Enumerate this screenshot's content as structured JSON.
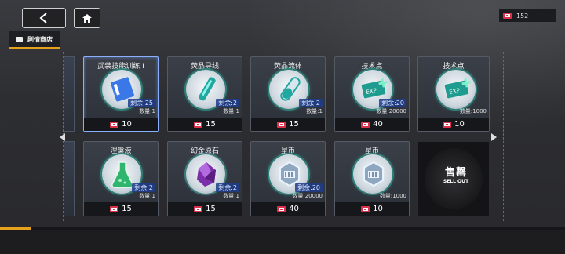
{
  "header": {
    "back_icon": "chevron-left-icon",
    "home_icon": "home-icon",
    "tab_label": "剧情商店",
    "currency_value": "152"
  },
  "items": [
    {
      "title": "武装技能训练 Ⅰ",
      "remain": "剩余:25",
      "qty": "数量:1",
      "price": "10",
      "icon": "skill-card-icon",
      "selected": true
    },
    {
      "title": "荧晶导线",
      "remain": "剩余:2",
      "qty": "数量:1",
      "price": "15",
      "icon": "crystal-wire-icon"
    },
    {
      "title": "荧晶流体",
      "remain": "剩余:2",
      "qty": "数量:1",
      "price": "15",
      "icon": "crystal-fluid-icon"
    },
    {
      "title": "技术点",
      "remain": "剩余:20",
      "qty": "数量:20000",
      "price": "40",
      "icon": "exp-ticket-icon"
    },
    {
      "title": "技术点",
      "remain": "",
      "qty": "数量:1000",
      "price": "10",
      "icon": "exp-ticket-icon"
    },
    {
      "title": "涅槃液",
      "remain": "剩余:2",
      "qty": "数量:1",
      "price": "15",
      "icon": "flask-icon"
    },
    {
      "title": "幻金原石",
      "remain": "剩余:2",
      "qty": "数量:1",
      "price": "15",
      "icon": "purple-ore-icon"
    },
    {
      "title": "星币",
      "remain": "剩余:20",
      "qty": "数量:20000",
      "price": "40",
      "icon": "star-coin-icon"
    },
    {
      "title": "星币",
      "remain": "",
      "qty": "数量:1000",
      "price": "10",
      "icon": "star-coin-icon"
    }
  ],
  "soldout": {
    "big": "售罄",
    "small": "SELL OUT"
  }
}
